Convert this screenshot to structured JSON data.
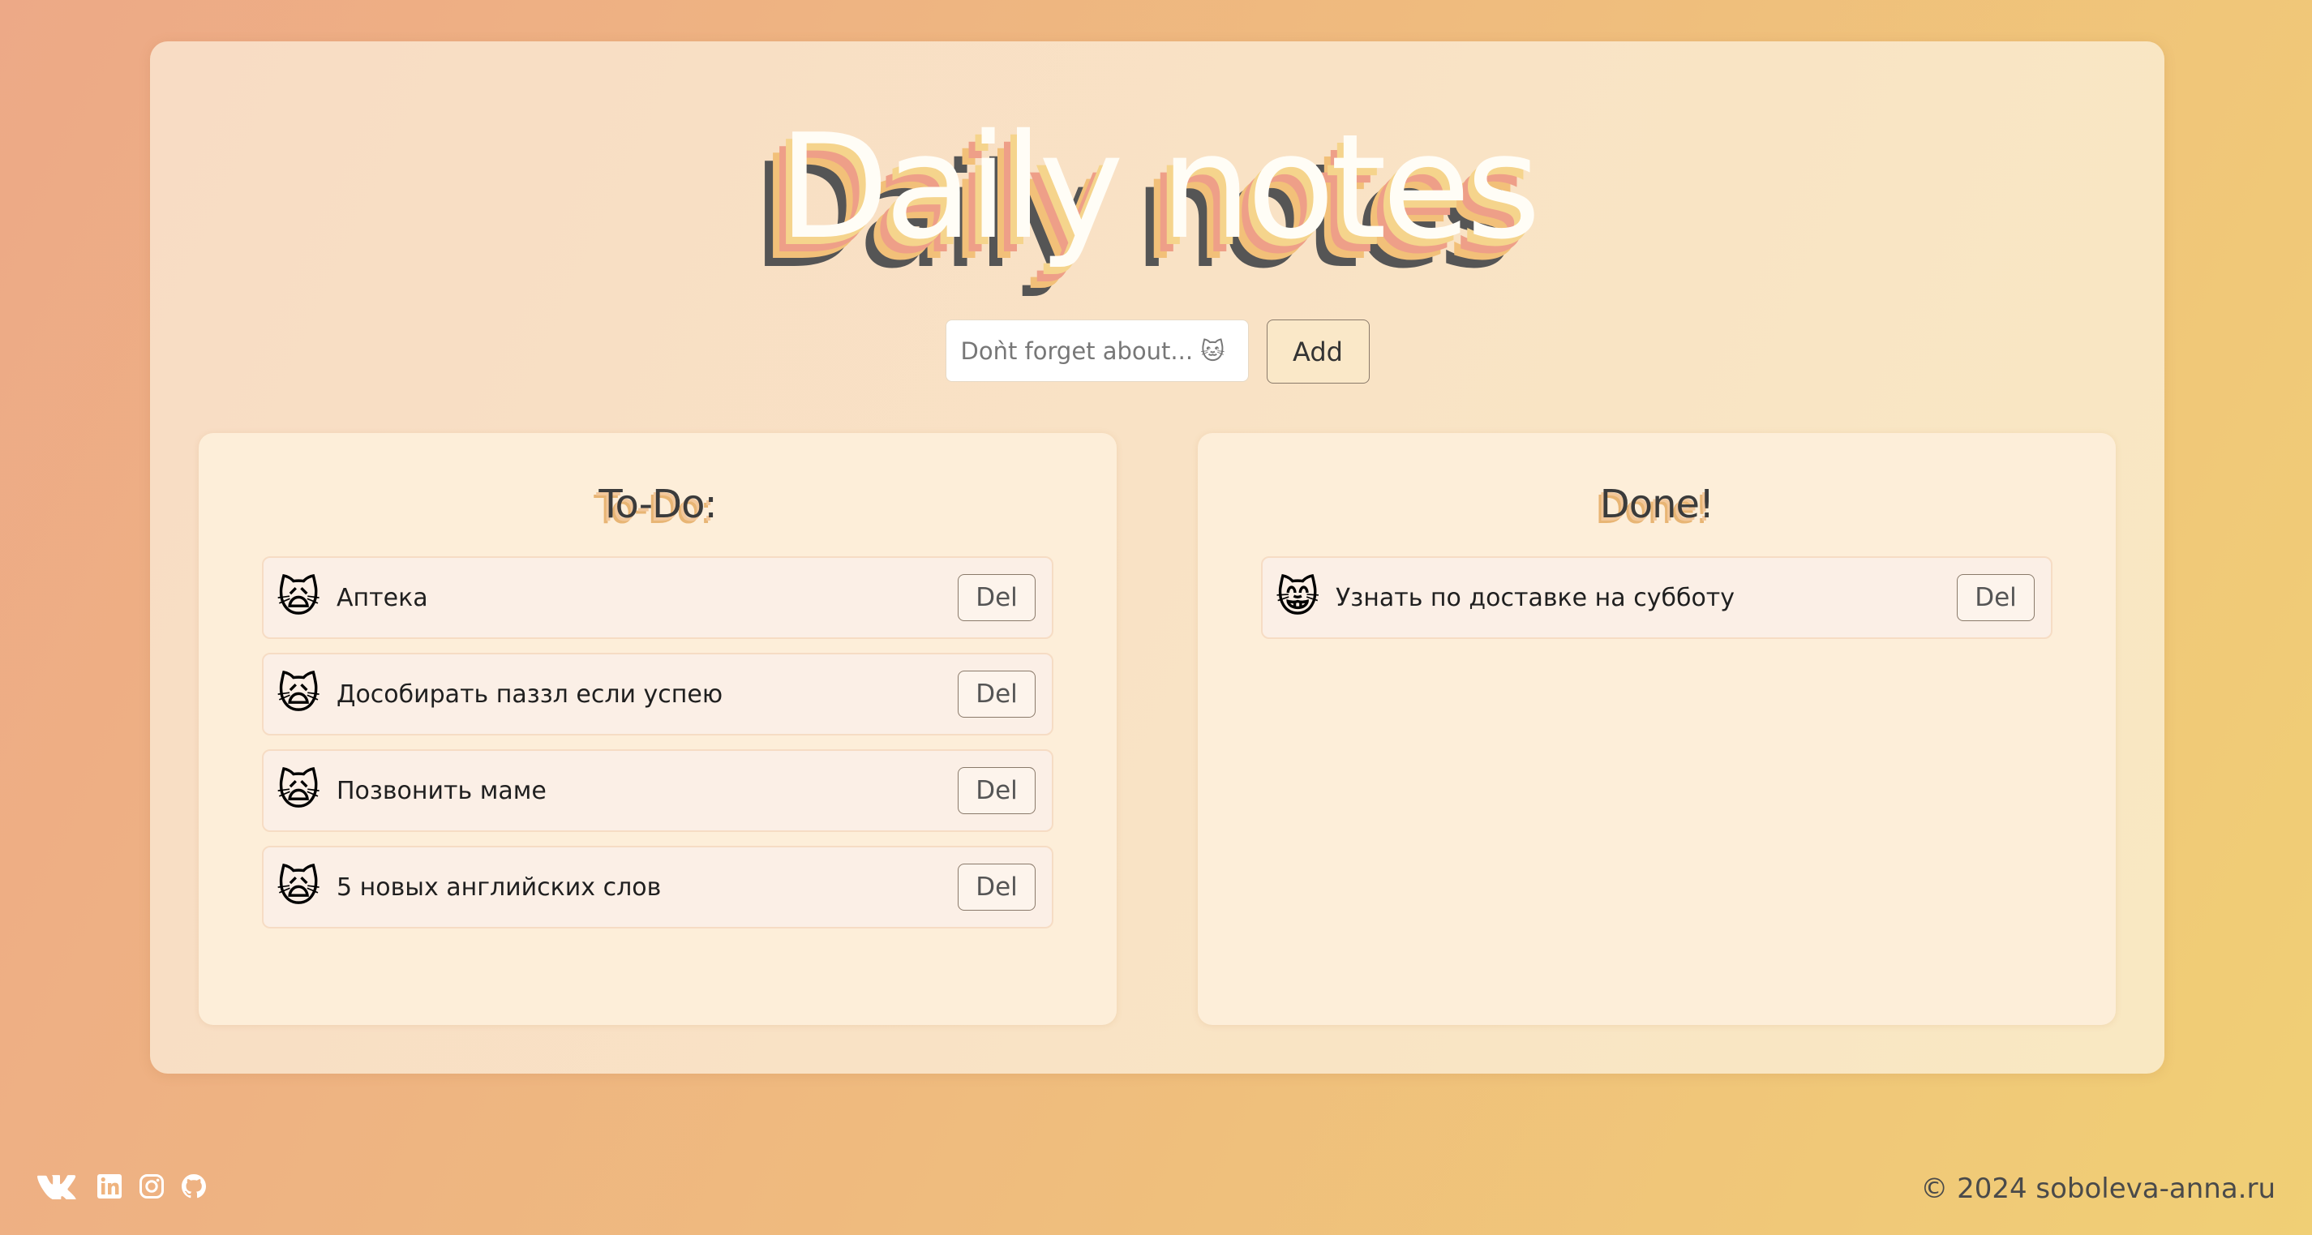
{
  "header": {
    "title": "Daily notes"
  },
  "input": {
    "placeholder": "Doǹt forget about... 🐱",
    "add_label": "Add"
  },
  "todo": {
    "title": "To-Do:",
    "items": [
      {
        "emoji": "🙀",
        "label": "Аптека",
        "del": "Del"
      },
      {
        "emoji": "🙀",
        "label": "Дособирать паззл если успею",
        "del": "Del"
      },
      {
        "emoji": "🙀",
        "label": "Позвонить маме",
        "del": "Del"
      },
      {
        "emoji": "🙀",
        "label": "5 новых английских слов",
        "del": "Del"
      }
    ]
  },
  "done": {
    "title": "Done!",
    "items": [
      {
        "emoji": "😸",
        "label": "Узнать по доставке на субботу",
        "del": "Del"
      }
    ]
  },
  "footer": {
    "icons": [
      "vk-icon",
      "linkedin-icon",
      "instagram-icon",
      "github-icon"
    ],
    "copyright": "© 2024 soboleva-anna.ru"
  },
  "colors": {
    "background_start": "#eda987",
    "background_end": "#f0cf75",
    "panel": "#fdeed9",
    "title_fill": "#fffdf6"
  }
}
